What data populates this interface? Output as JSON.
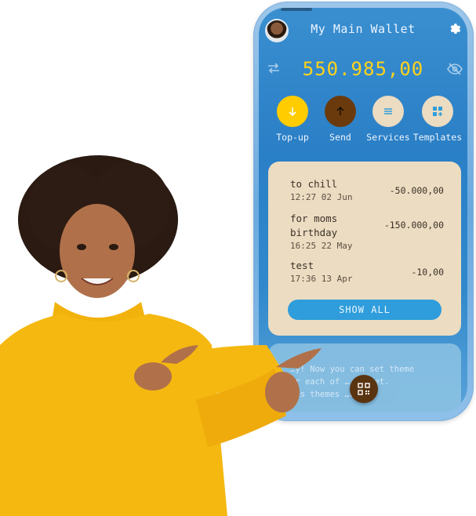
{
  "header": {
    "title": "My Main Wallet"
  },
  "balance": {
    "amount": "550.985,00"
  },
  "actions": [
    {
      "label": "Top-up",
      "icon": "arrow-down-icon",
      "color": "#ffcc00"
    },
    {
      "label": "Send",
      "icon": "arrow-up-icon",
      "color": "#6b3a0c"
    },
    {
      "label": "Services",
      "icon": "menu-icon",
      "color": "#ecdcc1"
    },
    {
      "label": "Templates",
      "icon": "grid-plus-icon",
      "color": "#ecdcc1"
    }
  ],
  "transactions": [
    {
      "name": "to chill",
      "time": "12:27 02 Jun",
      "amount": "-50.000,00"
    },
    {
      "name": "for moms\nbirthday",
      "time": "16:25 22 May",
      "amount": "-150.000,00"
    },
    {
      "name": "test",
      "time": "17:36 13 Apr",
      "amount": "-10,00"
    }
  ],
  "show_all_label": "SHOW ALL",
  "news": {
    "text": "…y! Now you can set theme\n…r each of … wallet.\n…ds themes …uded!"
  },
  "colors": {
    "accent": "#2f9ddb",
    "balance": "#ffd31a",
    "card": "#ecdcc1",
    "fab": "#5a3310"
  }
}
